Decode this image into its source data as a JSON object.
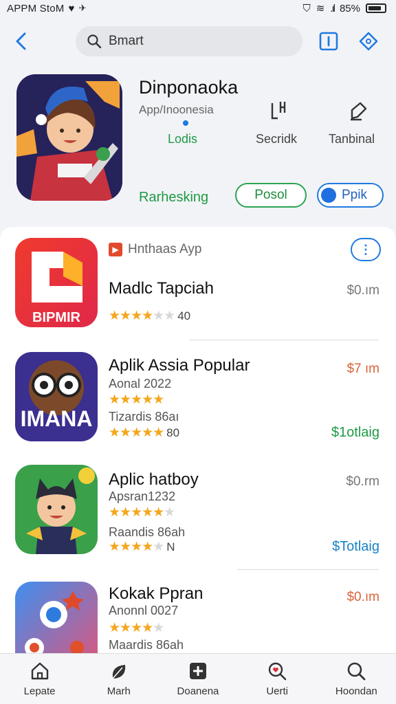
{
  "status_bar": {
    "left_text": "APPM StoM",
    "battery": "85%",
    "signal_label": "85%"
  },
  "top_bar": {
    "search_value": "Bmart"
  },
  "hero": {
    "title": "Dinponaoka",
    "subtitle": "App/Inoonesia",
    "stats": [
      {
        "label": "Lodis",
        "icon": "dot-icon"
      },
      {
        "label": "Secridk",
        "icon": "bracket-icon"
      },
      {
        "label": "Tanbinal",
        "icon": "edit-icon"
      }
    ],
    "rank_label": "Rarhesking",
    "btn_green": "Posol",
    "btn_blue": "Ppik"
  },
  "list": {
    "section_tag": "Hnthaas Ayp",
    "items": [
      {
        "name": "Madlc Tapciah",
        "icon_text": "BIPMIR",
        "rating": 4,
        "rating_text": "40",
        "price": "$0.ım"
      },
      {
        "name": "Aplik Assia Popular",
        "icon_text": "IMANA",
        "sub1": "Aonal 2022",
        "sub2": "Tizardis 86aı",
        "rating": 5,
        "rating_text": "80",
        "price": "$7 ım",
        "status": "$1otlaig"
      },
      {
        "name": "Aplic hatboy",
        "sub1": "Apsran1232",
        "sub2": "Raandis 86ah",
        "rating": 5,
        "rating2": 4,
        "rating_text": "N",
        "price": "$0.rm",
        "status": "$Totlaig"
      },
      {
        "name": "Kokak Ppran",
        "sub1": "Anonnl 0027",
        "sub2": "Maardis 86ah",
        "rating": 4,
        "price": "$0.ım"
      }
    ]
  },
  "bottom_nav": [
    {
      "label": "Lepate",
      "icon": "home-icon"
    },
    {
      "label": "Marh",
      "icon": "leaf-icon"
    },
    {
      "label": "Doanena",
      "icon": "plus-square-icon"
    },
    {
      "label": "Uerti",
      "icon": "search-heart-icon"
    },
    {
      "label": "Hoondan",
      "icon": "search-icon"
    }
  ],
  "colors": {
    "accent": "#1f7ae0",
    "green": "#1f9a44",
    "star": "#f4a71d"
  }
}
